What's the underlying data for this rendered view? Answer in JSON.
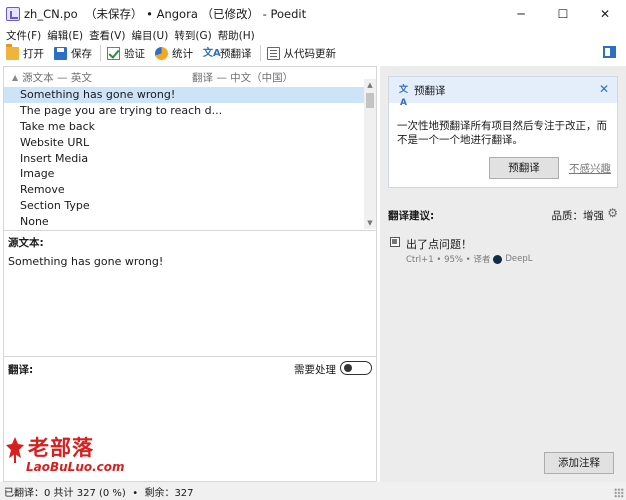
{
  "window": {
    "title": "zh_CN.po  （未保存） • Angora （已修改） - Poedit",
    "minimize": "─",
    "maximize": "☐",
    "close": "✕"
  },
  "menu": [
    "文件(F)",
    "编辑(E)",
    "查看(V)",
    "编目(U)",
    "转到(G)",
    "帮助(H)"
  ],
  "toolbar": {
    "open": "打开",
    "save": "保存",
    "validate": "验证",
    "stats": "统计",
    "pretranslate": "预翻译",
    "update_from_code": "从代码更新"
  },
  "list": {
    "header_source": "源文本 — 英文",
    "header_translation": "翻译 — 中文（中国）",
    "sort_glyph": "▲",
    "rows": [
      "Something has gone wrong!",
      "The page you are trying to reach d...",
      "Take me back",
      "Website URL",
      "Insert Media",
      "Image",
      "Remove",
      "Section Type",
      "None"
    ],
    "selected_index": 0,
    "scroll_up": "▲",
    "scroll_down": "▼"
  },
  "source": {
    "label": "源文本:",
    "text": "Something has gone wrong!"
  },
  "translation": {
    "label": "翻译:",
    "needs_work_label": "需要处理",
    "needs_work_on": false
  },
  "pretranslate_panel": {
    "title": "预翻译",
    "close": "✕",
    "description": "一次性地预翻译所有项目然后专注于改正，而不是一个一个地进行翻译。",
    "button": "预翻译",
    "dismiss": "不感兴趣"
  },
  "suggestions": {
    "label": "翻译建议:",
    "quality": "品质：增强",
    "gear": "⚙",
    "items": [
      {
        "text": "出了点问题！",
        "meta": "Ctrl+1 • 95% • 译者",
        "provider": "DeepL"
      }
    ]
  },
  "add_comment": "添加注释",
  "watermark": {
    "main": "老部落",
    "sub": "LaoBuLuo.com"
  },
  "status": "已翻译：0 共计 327 (0 %)  •  剩余：327",
  "colors": {
    "selection": "#cde3f8",
    "panel_header": "#e4eefa",
    "accent": "#2d6fc3",
    "watermark": "#d81e1e"
  }
}
